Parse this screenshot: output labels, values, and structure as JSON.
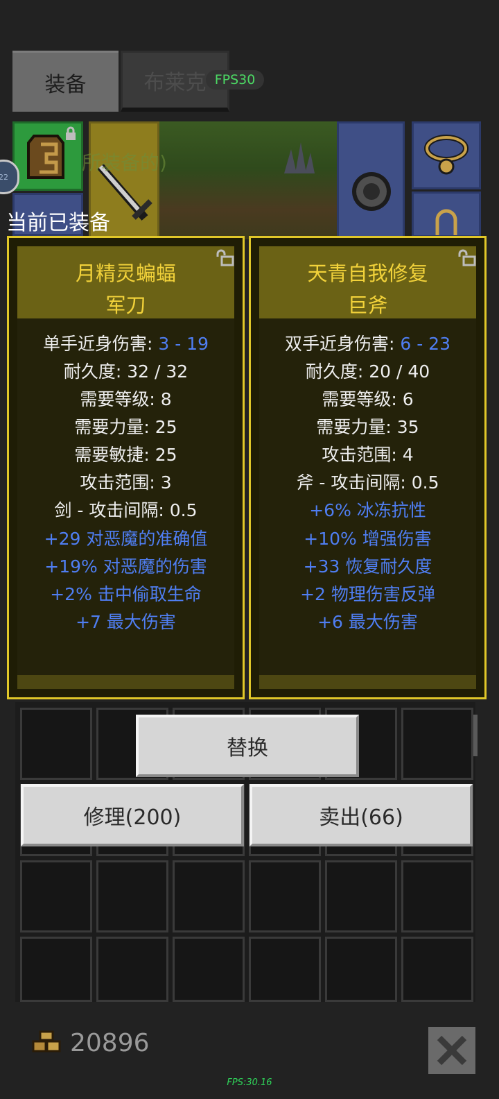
{
  "tabs": {
    "equipment": "装备",
    "blake": "布莱克"
  },
  "fps_badge": "FPS30",
  "ghost_text": "所装备的)",
  "left_badge": "22",
  "equipped_label": "当前已装备",
  "cards": [
    {
      "name_line1": "月精灵蝙蝠",
      "name_line2": "军刀",
      "stats": [
        {
          "label": "单手近身伤害: ",
          "value": "3 - 19"
        },
        {
          "label": "耐久度: 32 / 32"
        },
        {
          "label": "需要等级: 8"
        },
        {
          "label": "需要力量: 25"
        },
        {
          "label": "需要敏捷: 25"
        },
        {
          "label": "攻击范围: 3"
        },
        {
          "label": "剑 - 攻击间隔: 0.5"
        }
      ],
      "mods": [
        "+29 对恶魔的准确值",
        "+19% 对恶魔的伤害",
        "+2% 击中偷取生命",
        "+7 最大伤害"
      ]
    },
    {
      "name_line1": "天青自我修复",
      "name_line2": "巨斧",
      "stats": [
        {
          "label": "双手近身伤害: ",
          "value": "6 - 23"
        },
        {
          "label": "耐久度: 20 / 40"
        },
        {
          "label": "需要等级: 6"
        },
        {
          "label": "需要力量: 35"
        },
        {
          "label": "攻击范围: 4"
        },
        {
          "label": "斧 - 攻击间隔: 0.5"
        }
      ],
      "mods": [
        "+6% 冰冻抗性",
        "+10% 增强伤害",
        "+33 恢复耐久度",
        "+2 物理伤害反弹",
        "+6 最大伤害"
      ]
    }
  ],
  "buttons": {
    "replace": "替换",
    "repair": "修理(200)",
    "sell": "卖出(66)"
  },
  "gold_amount": "20896",
  "fps_bottom": "FPS:30.16",
  "colors": {
    "card_border": "#e0c729",
    "item_name": "#f2d23a",
    "magic_stat": "#4f7ef2",
    "fps": "#2fd65a"
  }
}
